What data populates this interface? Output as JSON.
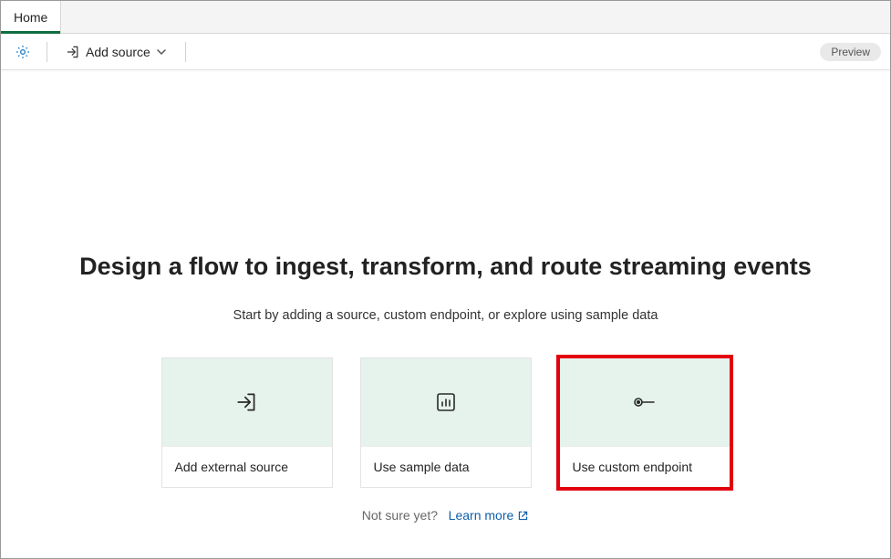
{
  "tabs": {
    "home": "Home"
  },
  "toolbar": {
    "add_source_label": "Add source",
    "preview_badge": "Preview"
  },
  "main": {
    "headline": "Design a flow to ingest, transform, and route streaming events",
    "subtext": "Start by adding a source, custom endpoint, or explore using sample data"
  },
  "cards": {
    "external_source": "Add external source",
    "sample_data": "Use sample data",
    "custom_endpoint": "Use custom endpoint"
  },
  "learn_more": {
    "prefix": "Not sure yet?",
    "link": "Learn more"
  }
}
